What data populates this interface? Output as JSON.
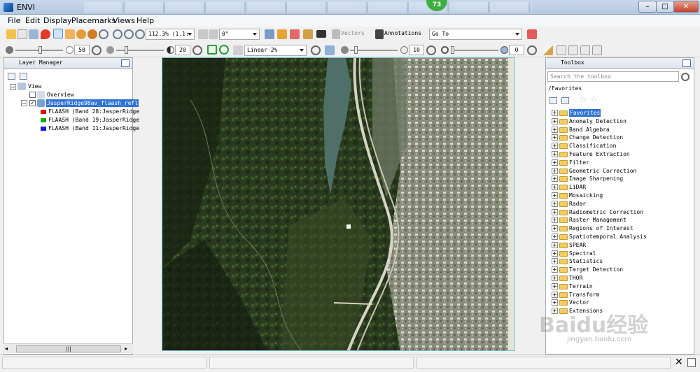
{
  "window": {
    "title": "ENVI",
    "notification_count": "73"
  },
  "menu": [
    "File",
    "Edit",
    "Display",
    "Placemarks",
    "Views",
    "Help"
  ],
  "toolbar1": {
    "zoom": "112.3% (1.1:",
    "rotation": "0°",
    "vectors_label": "Vectors",
    "annotations_label": "Annotations",
    "goto_label": "Go To"
  },
  "toolbar2": {
    "brightness": "50",
    "contrast": "20",
    "stretch": "Linear 2%",
    "sharpen": "10",
    "transparency": "0"
  },
  "layer_manager": {
    "title": "Layer Manager",
    "tree": {
      "view": "View",
      "overview": "Overview",
      "layer": "JasperRidge98av_flaash_refl",
      "bands": [
        {
          "label": "FLAASH (Band 28:JasperRidge",
          "color": "#e01010"
        },
        {
          "label": "FLAASH (Band 19:JasperRidge",
          "color": "#10b010"
        },
        {
          "label": "FLAASH (Band 11:JasperRidge",
          "color": "#1020d0"
        }
      ]
    },
    "scroll_thumb": "|||"
  },
  "toolbox": {
    "title": "Toolbox",
    "search_placeholder": "Search the toolbox",
    "path": "/Favorites",
    "items": [
      "Favorites",
      "Anomaly Detection",
      "Band Algebra",
      "Change Detection",
      "Classification",
      "Feature Extraction",
      "Filter",
      "Geometric Correction",
      "Image Sharpening",
      "LiDAR",
      "Mosaicking",
      "Radar",
      "Radiometric Correction",
      "Raster Management",
      "Regions of Interest",
      "Spatiotemporal Analysis",
      "SPEAR",
      "Spectral",
      "Statistics",
      "Target Detection",
      "THOR",
      "Terrain",
      "Transform",
      "Vector",
      "Extensions"
    ]
  },
  "watermark": {
    "text": "Baidu经验",
    "subtext": "jingyan.baidu.com"
  }
}
